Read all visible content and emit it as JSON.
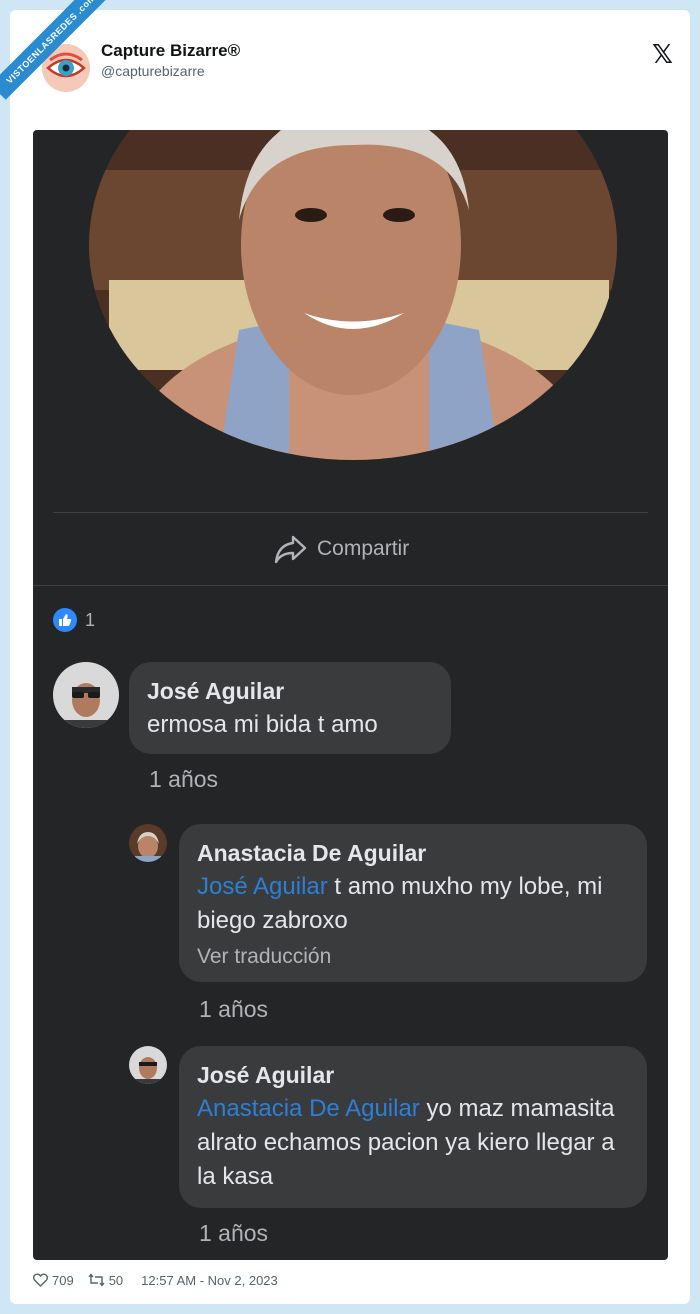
{
  "watermark": "VISTOENLASREDES .com",
  "tweet": {
    "author_name": "Capture Bizarre®",
    "author_handle": "@capturebizarre",
    "platform_icon": "x-logo-icon",
    "footer": {
      "likes": "709",
      "retweets": "50",
      "timestamp": "12:57 AM - Nov 2, 2023"
    }
  },
  "screenshot": {
    "share_label": "Compartir",
    "reaction_count": "1",
    "comments": [
      {
        "name": "José Aguilar",
        "text": "ermosa mi bida t amo",
        "time": "1 años"
      },
      {
        "name": "Anastacia De Aguilar",
        "mention": "José Aguilar",
        "text": " t amo muxho my lobe, mi biego zabroxo",
        "translate": "Ver traducción",
        "time": "1 años"
      },
      {
        "name": "José Aguilar",
        "mention": "Anastacia De Aguilar",
        "text": " yo maz mamasita alrato echamos pacion ya kiero llegar a la kasa",
        "time": "1 años"
      }
    ]
  },
  "colors": {
    "fb_dark_bg": "#242526",
    "bubble_bg": "#3a3b3c",
    "mention": "#2d7fd6",
    "like_blue": "#2e89ff"
  }
}
